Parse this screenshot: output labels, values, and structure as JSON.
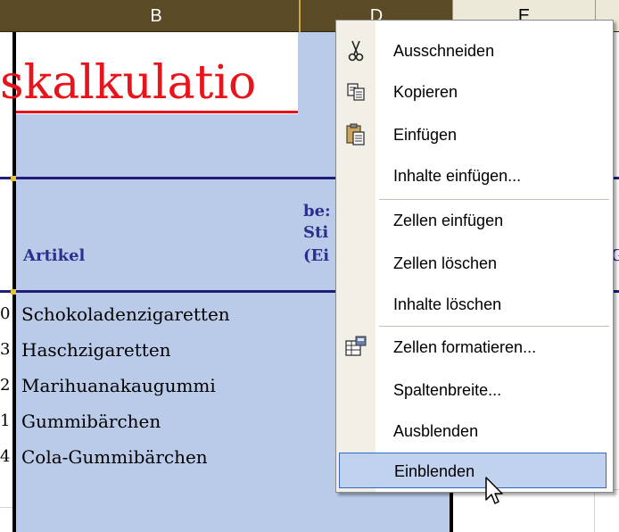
{
  "columns": {
    "b": "B",
    "d": "D",
    "e": "E"
  },
  "sheet": {
    "title": "skalkulatio",
    "artikel_header": "Artikel",
    "d_header_lines": [
      "be:",
      "Sti",
      "(Ei"
    ],
    "f_partial": "G",
    "rows": [
      {
        "num": "0",
        "text": "Schokoladenzigaretten"
      },
      {
        "num": "3",
        "text": "Haschzigaretten"
      },
      {
        "num": "2",
        "text": "Marihuanakaugummi"
      },
      {
        "num": "1",
        "text": "Gummibärchen"
      },
      {
        "num": "4",
        "text": "Cola-Gummibärchen"
      }
    ]
  },
  "context_menu": {
    "items": [
      {
        "id": "cut",
        "label": "Ausschneiden",
        "icon": "scissors-icon"
      },
      {
        "id": "copy",
        "label": "Kopieren",
        "icon": "copy-icon"
      },
      {
        "id": "paste",
        "label": "Einfügen",
        "icon": "paste-icon"
      },
      {
        "id": "paste-special",
        "label": "Inhalte einfügen...",
        "icon": ""
      },
      {
        "id": "insert-cells",
        "label": "Zellen einfügen",
        "icon": ""
      },
      {
        "id": "delete-cells",
        "label": "Zellen löschen",
        "icon": ""
      },
      {
        "id": "clear-contents",
        "label": "Inhalte löschen",
        "icon": ""
      },
      {
        "id": "format-cells",
        "label": "Zellen formatieren...",
        "icon": "format-cells-icon"
      },
      {
        "id": "column-width",
        "label": "Spaltenbreite...",
        "icon": ""
      },
      {
        "id": "hide",
        "label": "Ausblenden",
        "icon": ""
      },
      {
        "id": "unhide",
        "label": "Einblenden",
        "icon": "",
        "highlighted": true
      }
    ]
  },
  "colors": {
    "selection": "#b9cbe8",
    "title_red": "#e8141b",
    "header_blue": "#2b2f8f",
    "menu_highlight": "#c1d2ee"
  }
}
